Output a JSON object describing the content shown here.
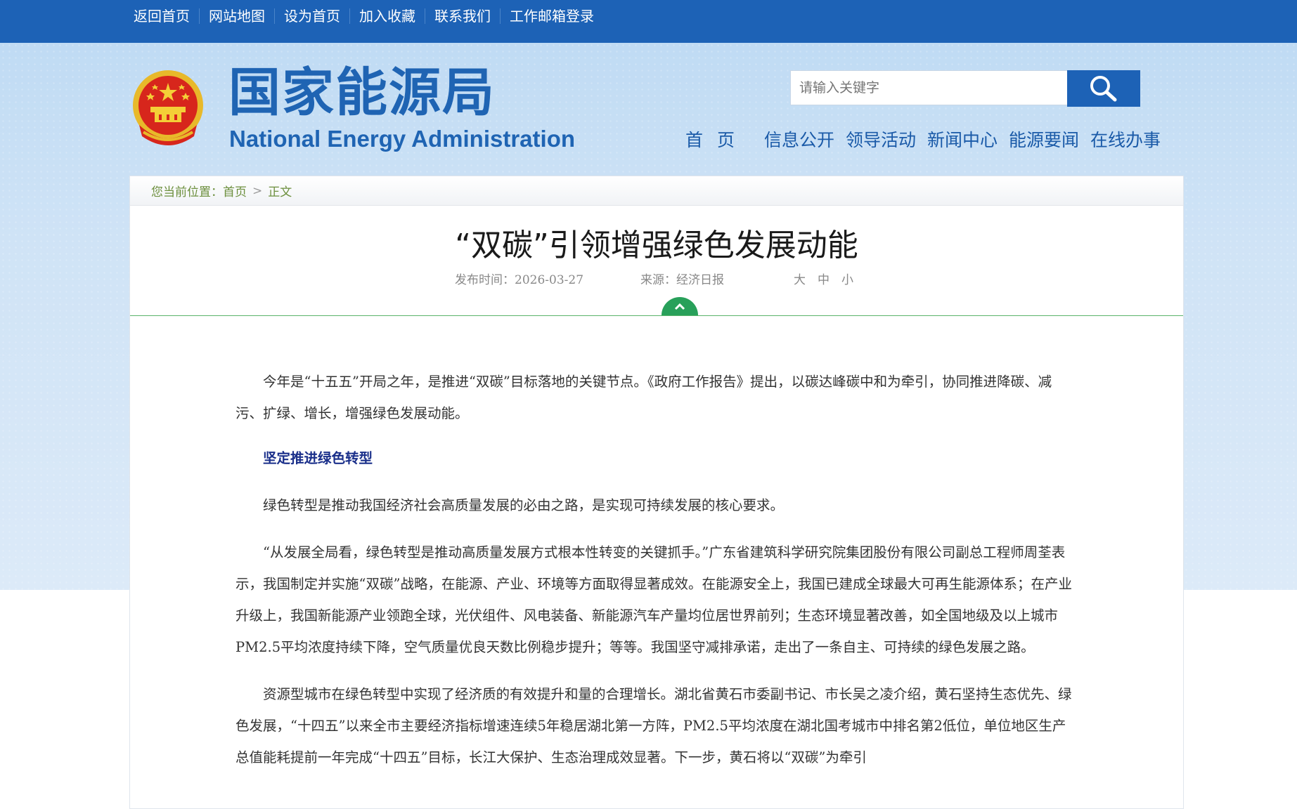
{
  "topnav": [
    "返回首页",
    "网站地图",
    "设为首页",
    "加入收藏",
    "联系我们",
    "工作邮箱登录"
  ],
  "logo": {
    "cn": "国家能源局",
    "en": "National Energy Administration"
  },
  "search": {
    "placeholder": "请输入关键字"
  },
  "mainnav": [
    "首 页",
    "信息公开",
    "领导活动",
    "新闻中心",
    "能源要闻",
    "在线办事"
  ],
  "breadcrumb": {
    "prefix": "您当前位置：",
    "home": "首页",
    "sep": ">",
    "current": "正文"
  },
  "article": {
    "title": "“双碳”引领增强绿色发展动能",
    "publish_time": "发布时间：2026-03-27",
    "source": "来源：经济日报",
    "font_sizes": [
      "大",
      "中",
      "小"
    ],
    "paragraphs": [
      "今年是“十五五”开局之年，是推进“双碳”目标落地的关键节点。《政府工作报告》提出，以碳达峰碳中和为牵引，协同推进降碳、减污、扩绿、增长，增强绿色发展动能。",
      "坚定推进绿色转型",
      "绿色转型是推动我国经济社会高质量发展的必由之路，是实现可持续发展的核心要求。",
      "“从发展全局看，绿色转型是推动高质量发展方式根本性转变的关键抓手。”广东省建筑科学研究院集团股份有限公司副总工程师周荃表示，我国制定并实施“双碳”战略，在能源、产业、环境等方面取得显著成效。在能源安全上，我国已建成全球最大可再生能源体系；在产业升级上，我国新能源产业领跑全球，光伏组件、风电装备、新能源汽车产量均位居世界前列；生态环境显著改善，如全国地级及以上城市PM2.5平均浓度持续下降，空气质量优良天数比例稳步提升；等等。我国坚守减排承诺，走出了一条自主、可持续的绿色发展之路。",
      "资源型城市在绿色转型中实现了经济质的有效提升和量的合理增长。湖北省黄石市委副书记、市长吴之凌介绍，黄石坚持生态优先、绿色发展，“十四五”以来全市主要经济指标增速连续5年稳居湖北第一方阵，PM2.5平均浓度在湖北国考城市中排名第2低位，单位地区生产总值能耗提前一年完成“十四五”目标，长江大保护、生态治理成效显著。下一步，黄石将以“双碳”为牵引"
    ]
  },
  "colors": {
    "topbar": "#1d62b6",
    "brand": "#1f64b3",
    "accent_green": "#28a05a",
    "subhead": "#1a2f8a"
  }
}
